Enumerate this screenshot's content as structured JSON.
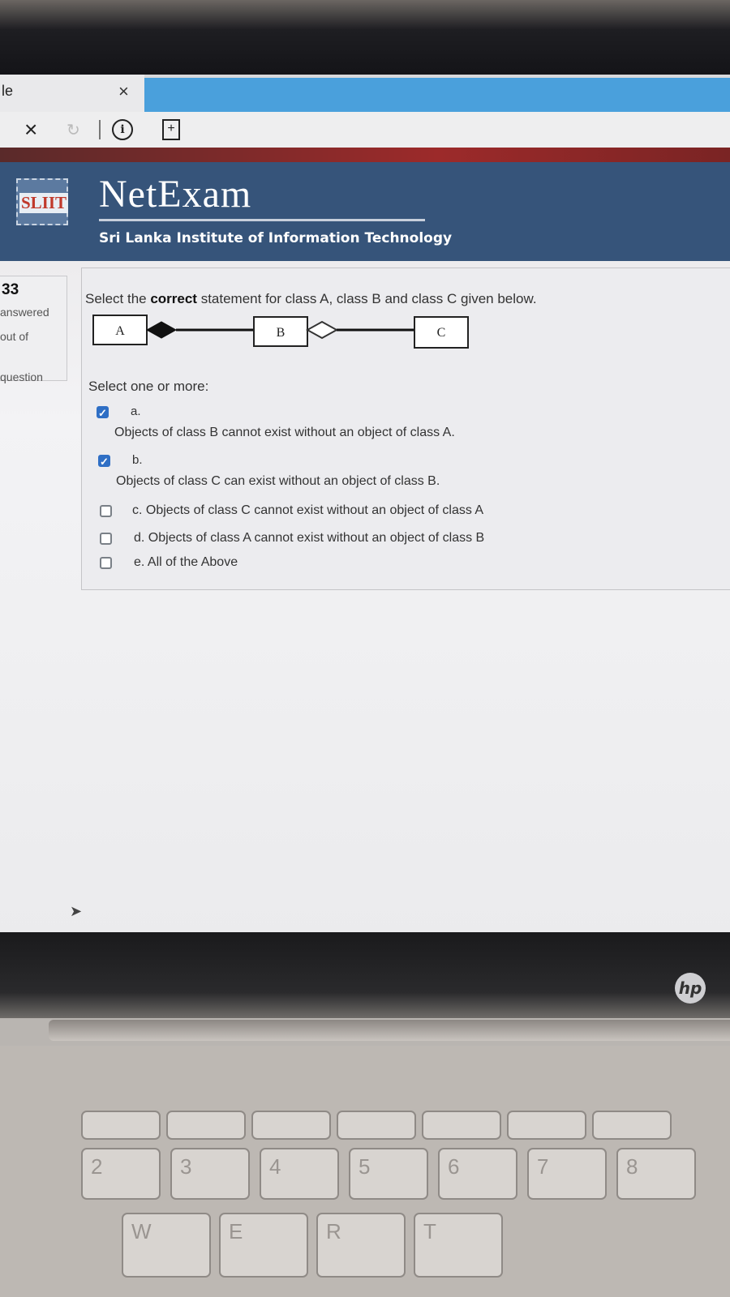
{
  "browser": {
    "tab_title": "le",
    "tab_close_glyph": "×",
    "toolbar_close_glyph": "×",
    "reload_glyph": "↻",
    "info_glyph": "i",
    "page_glyph": "+"
  },
  "header": {
    "logo_text": "SLIIT",
    "brand": "NetExam",
    "institute": "Sri Lanka Institute of Information Technology"
  },
  "question_info": {
    "number": "33",
    "status": "answered",
    "marks": "out of",
    "flag_label": "question"
  },
  "question": {
    "prompt_pre": "Select the ",
    "prompt_bold": "correct",
    "prompt_post": " statement for class A, class B and class C given below.",
    "diagram": {
      "class_a": "A",
      "class_b": "B",
      "class_c": "C"
    },
    "select_label": "Select one or more:",
    "options": [
      {
        "letter": "a.",
        "text": "Objects of class B cannot exist without an object of class A.",
        "checked": true
      },
      {
        "letter": "b.",
        "text": "Objects of class C can exist without an object of class B.",
        "checked": true
      },
      {
        "letter": "",
        "text": "c. Objects of class C cannot exist without an object of class A",
        "checked": false
      },
      {
        "letter": "",
        "text": "d. Objects of class A cannot exist without an object of class B",
        "checked": false
      },
      {
        "letter": "",
        "text": "e. All of the Above",
        "checked": false
      }
    ]
  },
  "laptop": {
    "brand_logo": "hp",
    "keys": [
      "2",
      "3",
      "4",
      "5",
      "6",
      "7",
      "8",
      "W",
      "E",
      "R",
      "T"
    ]
  },
  "colors": {
    "header_bg": "#36547a",
    "accent_bar": "#9c2a2a",
    "tab_active": "#4aa0dc",
    "checkbox_checked": "#2f6fc5"
  }
}
